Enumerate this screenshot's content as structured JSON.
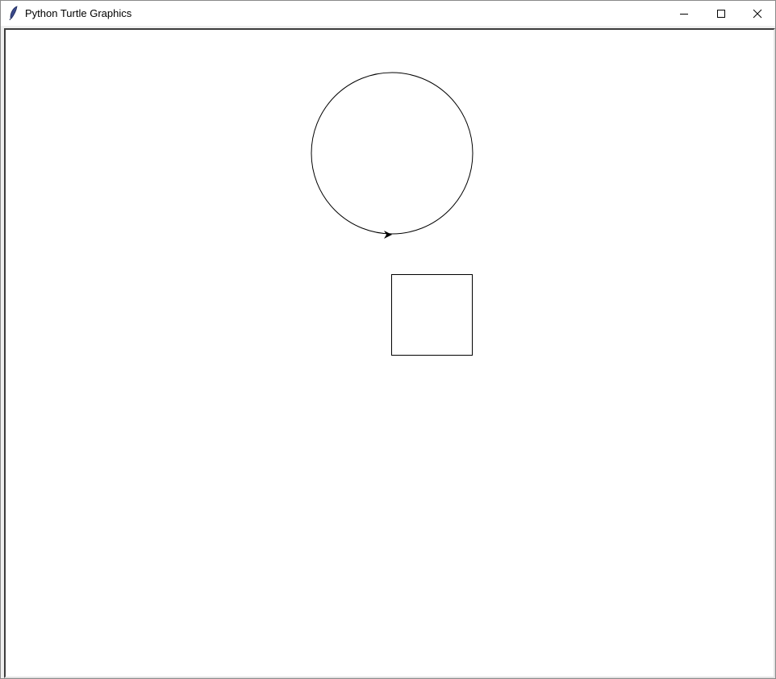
{
  "window": {
    "title": "Python Turtle Graphics",
    "app_icon": "feather-icon",
    "controls": {
      "minimize": "minimize-icon",
      "maximize": "maximize-icon",
      "close": "close-icon"
    }
  },
  "canvas": {
    "background": "#ffffff",
    "pen_color": "#000000",
    "shapes": [
      "circle",
      "square"
    ],
    "turtle_icon": "turtle-arrow-icon",
    "turtle_heading": "east"
  }
}
